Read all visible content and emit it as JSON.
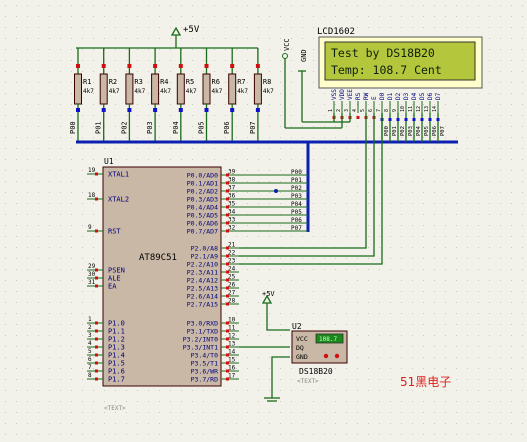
{
  "colors": {
    "background": "#f2f2ea",
    "grid_dot": "#c8c8c0",
    "wire": "#1a6b1a",
    "bus": "#0b1fb0",
    "chip_fill": "#c9b8a6",
    "chip_border": "#3a0000",
    "lcd_frame": "#ffffcc",
    "lcd_screen": "#b4c63c",
    "lcd_text": "#102010",
    "pin_label": "#000080",
    "label": "#000000",
    "brand_text": "#e0201e",
    "pin_end_red": "#d01010",
    "pin_end_blue": "#1010d0"
  },
  "power": {
    "vcc_top": "+5V",
    "vcc_mid": "+5V",
    "vcc_lcd": "VCC",
    "gnd_lcd": "GND"
  },
  "resistors": {
    "names": [
      "R1",
      "R2",
      "R3",
      "R4",
      "R5",
      "R6",
      "R7",
      "R8"
    ],
    "value": "4k7",
    "net_labels": [
      "P00",
      "P01",
      "P02",
      "P03",
      "P04",
      "P05",
      "P06",
      "P07"
    ]
  },
  "lcd": {
    "ref": "LCD1602",
    "line1": "Test by DS18B20",
    "line2": "Temp: 108.7 Cent",
    "pins": [
      "VSS",
      "VDD",
      "VEE",
      "RS",
      "RW",
      "E",
      "D0",
      "D1",
      "D2",
      "D3",
      "D4",
      "D5",
      "D6",
      "D7"
    ],
    "pin_numbers": [
      "1",
      "2",
      "3",
      "4",
      "5",
      "6",
      "7",
      "8",
      "9",
      "10",
      "11",
      "12",
      "13",
      "14"
    ]
  },
  "u1": {
    "ref": "U1",
    "part": "AT89C51",
    "left_pins": [
      {
        "num": "19",
        "name": "XTAL1"
      },
      {
        "num": "18",
        "name": "XTAL2"
      },
      {
        "num": "9",
        "name": "RST"
      },
      {
        "num": "29",
        "name": "PSEN"
      },
      {
        "num": "30",
        "name": "ALE"
      },
      {
        "num": "31",
        "name": "EA"
      },
      {
        "num": "1",
        "name": "P1.0"
      },
      {
        "num": "2",
        "name": "P1.1"
      },
      {
        "num": "3",
        "name": "P1.2"
      },
      {
        "num": "4",
        "name": "P1.3"
      },
      {
        "num": "5",
        "name": "P1.4"
      },
      {
        "num": "6",
        "name": "P1.5"
      },
      {
        "num": "7",
        "name": "P1.6"
      },
      {
        "num": "8",
        "name": "P1.7"
      }
    ],
    "p0_pins": [
      {
        "num": "39",
        "name": "P0.0/AD0"
      },
      {
        "num": "38",
        "name": "P0.1/AD1"
      },
      {
        "num": "37",
        "name": "P0.2/AD2"
      },
      {
        "num": "36",
        "name": "P0.3/AD3"
      },
      {
        "num": "35",
        "name": "P0.4/AD4"
      },
      {
        "num": "34",
        "name": "P0.5/AD5"
      },
      {
        "num": "33",
        "name": "P0.6/AD6"
      },
      {
        "num": "32",
        "name": "P0.7/AD7"
      }
    ],
    "p2_pins": [
      {
        "num": "21",
        "name": "P2.0/A8"
      },
      {
        "num": "22",
        "name": "P2.1/A9"
      },
      {
        "num": "23",
        "name": "P2.2/A10"
      },
      {
        "num": "24",
        "name": "P2.3/A11"
      },
      {
        "num": "25",
        "name": "P2.4/A12"
      },
      {
        "num": "26",
        "name": "P2.5/A13"
      },
      {
        "num": "27",
        "name": "P2.6/A14"
      },
      {
        "num": "28",
        "name": "P2.7/A15"
      }
    ],
    "p3_pins": [
      {
        "num": "10",
        "name": "P3.0/RXD"
      },
      {
        "num": "11",
        "name": "P3.1/TXD"
      },
      {
        "num": "12",
        "name": "P3.2/INT0"
      },
      {
        "num": "13",
        "name": "P3.3/INT1"
      },
      {
        "num": "14",
        "name": "P3.4/T0"
      },
      {
        "num": "15",
        "name": "P3.5/T1"
      },
      {
        "num": "16",
        "name": "P3.6/WR"
      },
      {
        "num": "17",
        "name": "P3.7/RD"
      }
    ],
    "bus_labels": [
      "P00",
      "P01",
      "P02",
      "P03",
      "P04",
      "P05",
      "P06",
      "P07"
    ],
    "text_tag": "<TEXT>"
  },
  "u2": {
    "ref": "U2",
    "part": "DS18B20",
    "display": "108.7",
    "pins": [
      {
        "num": "2",
        "name": "VCC"
      },
      {
        "num": "1",
        "name": "DQ"
      },
      {
        "num": "3",
        "name": "GND"
      }
    ],
    "text_tag": "<TEXT>"
  },
  "brand": "51黑电子"
}
